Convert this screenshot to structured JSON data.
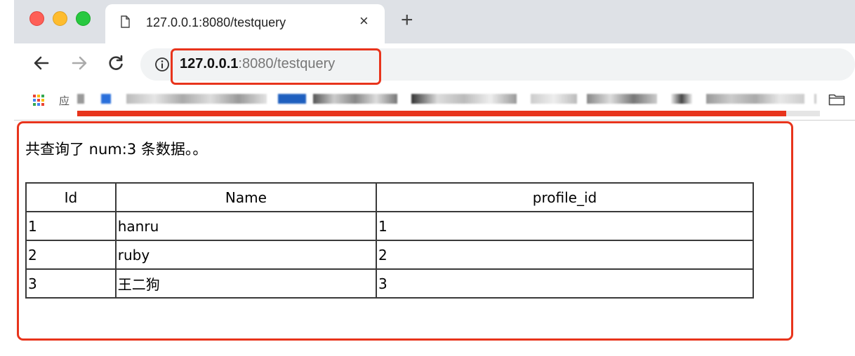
{
  "browser": {
    "tab": {
      "title": "127.0.0.1:8080/testquery",
      "close_glyph": "×",
      "page_icon": "page-icon"
    },
    "new_tab_glyph": "+",
    "nav": {
      "back_icon": "back-arrow-icon",
      "forward_icon": "forward-arrow-icon",
      "reload_icon": "reload-icon"
    },
    "address": {
      "host": "127.0.0.1",
      "path": ":8080/testquery",
      "info_icon": "info-icon"
    },
    "bookmarks": {
      "apps_label": "应",
      "folder_icon": "folder-icon"
    },
    "load_progress": 0.955,
    "colors": {
      "highlight": "#e8341c",
      "chrome_bg": "#dee1e6",
      "omnibox_bg": "#f1f3f4"
    }
  },
  "page": {
    "summary": "共查询了 num:3 条数据。。",
    "table": {
      "headers": [
        "Id",
        "Name",
        "profile_id"
      ],
      "rows": [
        [
          "1",
          "hanru",
          "1"
        ],
        [
          "2",
          "ruby",
          "2"
        ],
        [
          "3",
          "王二狗",
          "3"
        ]
      ]
    }
  }
}
